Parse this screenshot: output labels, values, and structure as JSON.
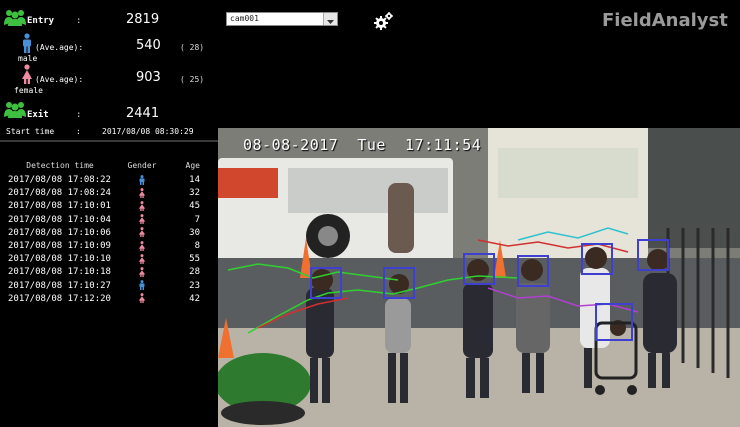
{
  "stats": {
    "entry_label": "Entry",
    "entry_value": "2819",
    "male_ave_label": "(Ave.age):",
    "male_label": "male",
    "male_value": "540",
    "male_age": "( 28)",
    "female_ave_label": "(Ave.age):",
    "female_label": "female",
    "female_value": "903",
    "female_age": "( 25)",
    "exit_label": "Exit",
    "exit_value": "2441",
    "colon": ":",
    "start_label": "Start time",
    "start_value": "2017/08/08 08:30:29"
  },
  "table": {
    "headers": {
      "time": "Detection time",
      "gender": "Gender",
      "age": "Age"
    },
    "rows": [
      {
        "time": "2017/08/08 17:08:22",
        "gender": "male",
        "age": "14"
      },
      {
        "time": "2017/08/08 17:08:24",
        "gender": "female",
        "age": "32"
      },
      {
        "time": "2017/08/08 17:10:01",
        "gender": "female",
        "age": "45"
      },
      {
        "time": "2017/08/08 17:10:04",
        "gender": "female",
        "age": "7"
      },
      {
        "time": "2017/08/08 17:10:06",
        "gender": "female",
        "age": "30"
      },
      {
        "time": "2017/08/08 17:10:09",
        "gender": "female",
        "age": "8"
      },
      {
        "time": "2017/08/08 17:10:10",
        "gender": "female",
        "age": "55"
      },
      {
        "time": "2017/08/08 17:10:18",
        "gender": "female",
        "age": "28"
      },
      {
        "time": "2017/08/08 17:10:27",
        "gender": "male",
        "age": "23"
      },
      {
        "time": "2017/08/08 17:12:20",
        "gender": "female",
        "age": "42"
      }
    ]
  },
  "camera": {
    "selected": "cam001",
    "timestamp": "08-08-2017  Tue  17:11:54"
  },
  "brand": "FieldAnalyst",
  "colors": {
    "group_icon": "#3fbf3f",
    "male": "#4a90d9",
    "female": "#f08aa0",
    "tracking_box": "#4040d0"
  },
  "icons": {
    "group": "group-people-icon",
    "male": "male-person-icon",
    "female": "female-person-icon",
    "settings": "gears-icon",
    "dropdown": "chevron-down-icon"
  }
}
